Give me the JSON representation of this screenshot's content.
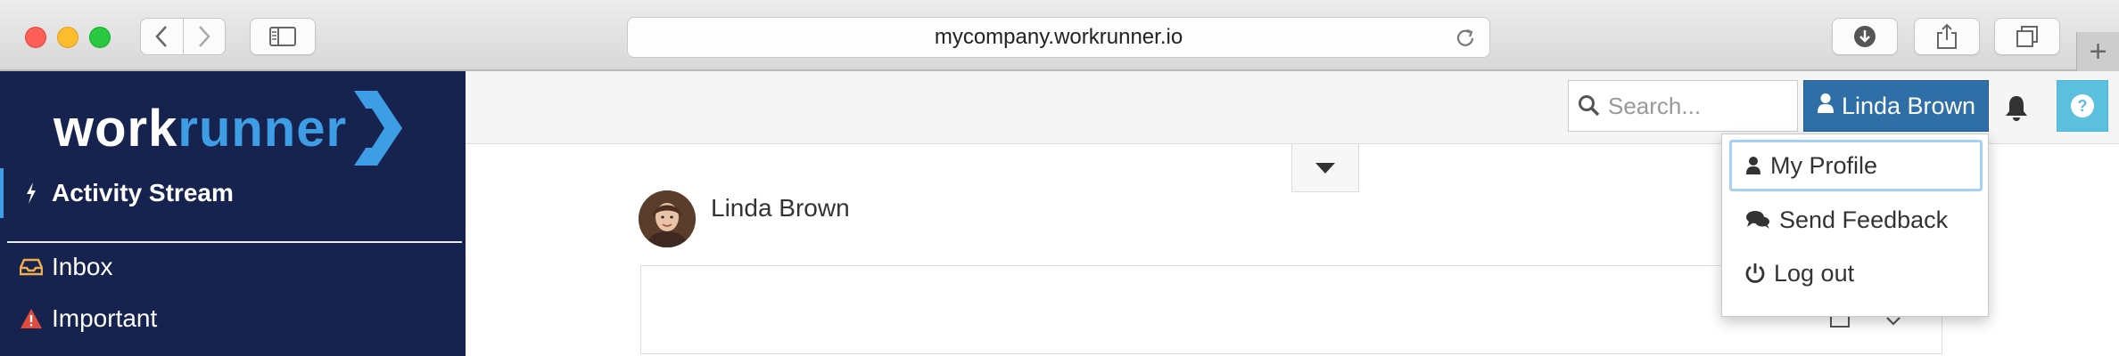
{
  "browser": {
    "url": "mycompany.workrunner.io"
  },
  "app": {
    "brand_left": "work",
    "brand_right": "runner"
  },
  "sidebar": {
    "items": [
      {
        "label": "Activity Stream",
        "icon": "bolt-icon",
        "active": true
      },
      {
        "label": "Inbox",
        "icon": "inbox-icon"
      },
      {
        "label": "Important",
        "icon": "warning-icon"
      }
    ]
  },
  "header": {
    "search_placeholder": "Search...",
    "user_name": "Linda Brown"
  },
  "user_menu": {
    "items": [
      {
        "label": "My Profile",
        "icon": "user-icon"
      },
      {
        "label": "Send Feedback",
        "icon": "comments-icon"
      },
      {
        "label": "Log out",
        "icon": "power-icon"
      }
    ]
  },
  "post": {
    "author": "Linda Brown"
  },
  "colors": {
    "sidebar_bg": "#16234e",
    "brand_accent": "#3d9ee6",
    "user_button": "#2f6fa7",
    "help_button": "#5bc0de"
  }
}
